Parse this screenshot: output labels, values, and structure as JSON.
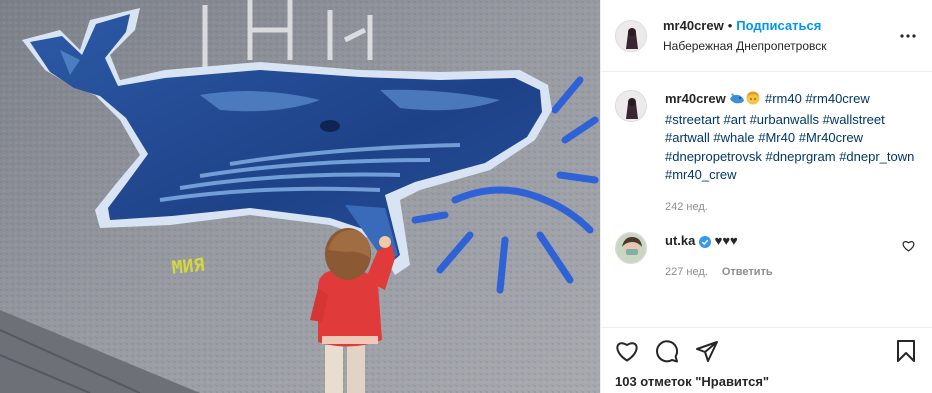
{
  "post": {
    "username": "mr40crew",
    "follow_label": "Подписаться",
    "location": "Набережная Днепропетровск",
    "caption": {
      "username": "mr40crew",
      "emojis": [
        "whale-emoji",
        "child-emoji"
      ],
      "hashtags": [
        "#rm40",
        "#rm40crew",
        "#streetart",
        "#art",
        "#urbanwalls",
        "#wallstreet",
        "#artwall",
        "#whale",
        "#Mr40",
        "#Mr40crew",
        "#dnepropetrovsk",
        "#dneprgram",
        "#dnepr_town",
        "#mr40_crew"
      ],
      "time": "242 нед."
    },
    "comments": [
      {
        "username": "ut.ka",
        "verified": true,
        "text": "♥♥♥",
        "time": "227 нед.",
        "reply_label": "Ответить"
      }
    ],
    "likes_text": "103 отметок \"Нравится\"",
    "graffiti_tag": "МИЯ"
  },
  "colors": {
    "accent": "#0095f6",
    "hashtag": "#00376b",
    "muted": "#8e8e8e",
    "whale_dark": "#1d3f80",
    "whale_light": "#6d9ed8",
    "jacket": "#e03a3a",
    "sun_blue": "#2f62d6"
  }
}
